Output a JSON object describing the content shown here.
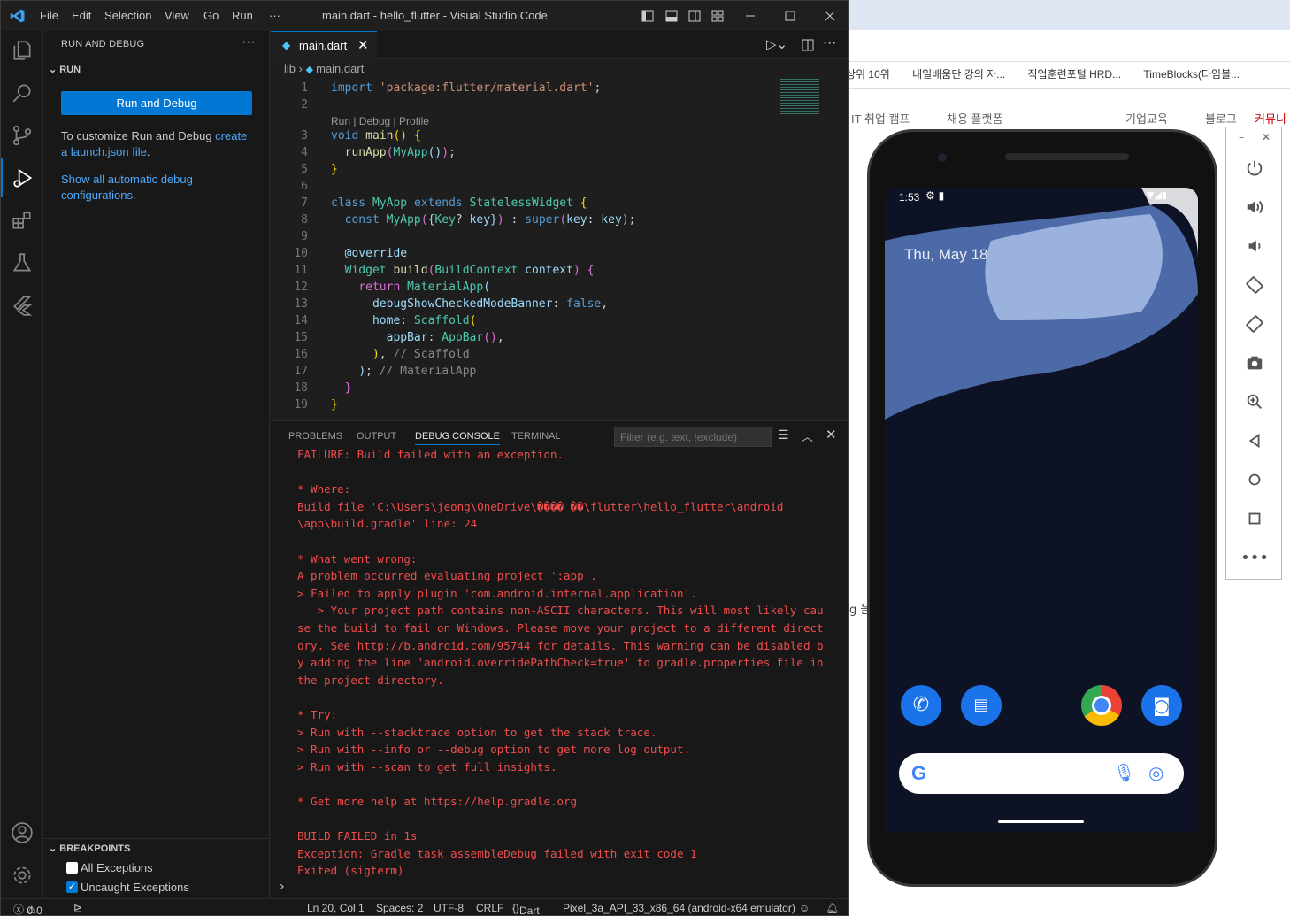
{
  "browser": {
    "bookmarks": [
      "상위 10위",
      "내일배움단 강의 자...",
      "직업훈련포털 HRD...",
      "TimeBlocks(타임블..."
    ],
    "nav": [
      "IT 취업 캠프",
      "채용 플랫폼",
      "기업교육",
      "블로그",
      "커뮤니"
    ],
    "side_text": "g 을"
  },
  "titlebar": {
    "menus": [
      "File",
      "Edit",
      "Selection",
      "View",
      "Go",
      "Run",
      "···"
    ],
    "title": "main.dart - hello_flutter - Visual Studio Code"
  },
  "sidebar": {
    "header": "RUN AND DEBUG",
    "run_section": "RUN",
    "run_button": "Run and Debug",
    "customize_text": "To customize Run and Debug ",
    "customize_link": "create a launch.json file",
    "customize_end": ".",
    "show_link": "Show all automatic debug configurations",
    "show_end": ".",
    "breakpoints": "BREAKPOINTS",
    "bp_all": "All Exceptions",
    "bp_uncaught": "Uncaught Exceptions"
  },
  "editor": {
    "tab": "main.dart",
    "crumb_folder": "lib",
    "crumb_file": "main.dart",
    "codelens": "Run | Debug | Profile"
  },
  "panel": {
    "tabs": [
      "PROBLEMS",
      "OUTPUT",
      "DEBUG CONSOLE",
      "TERMINAL"
    ],
    "filter_placeholder": "Filter (e.g. text, !exclude)",
    "console": [
      "FAILURE: Build failed with an exception.",
      "",
      "* Where:",
      "Build file 'C:\\Users\\jeong\\OneDrive\\���� ��\\flutter\\hello_flutter\\android",
      "\\app\\build.gradle' line: 24",
      "",
      "* What went wrong:",
      "A problem occurred evaluating project ':app'.",
      "> Failed to apply plugin 'com.android.internal.application'.",
      "   > Your project path contains non-ASCII characters. This will most likely cau",
      "se the build to fail on Windows. Please move your project to a different direct",
      "ory. See http://b.android.com/95744 for details. This warning can be disabled b",
      "y adding the line 'android.overridePathCheck=true' to gradle.properties file in",
      "the project directory.",
      "",
      "* Try:",
      "> Run with --stacktrace option to get the stack trace.",
      "> Run with --info or --debug option to get more log output.",
      "> Run with --scan to get full insights.",
      "",
      "* Get more help at https://help.gradle.org",
      "",
      "BUILD FAILED in 1s",
      "Exception: Gradle task assembleDebug failed with exit code 1",
      "Exited (sigterm)"
    ]
  },
  "statusbar": {
    "errors": "0",
    "warnings": "0",
    "position": "Ln 20, Col 1",
    "spaces": "Spaces: 2",
    "encoding": "UTF-8",
    "eol": "CRLF",
    "language": "Dart",
    "device": "Pixel_3a_API_33_x86_64 (android-x64 emulator)"
  },
  "emulator": {
    "time": "1:53",
    "date": "Thu, May 18"
  },
  "colors": {
    "accent": "#0078d4",
    "error_text": "#f14c4c",
    "editor_bg": "#1e1e1e"
  }
}
